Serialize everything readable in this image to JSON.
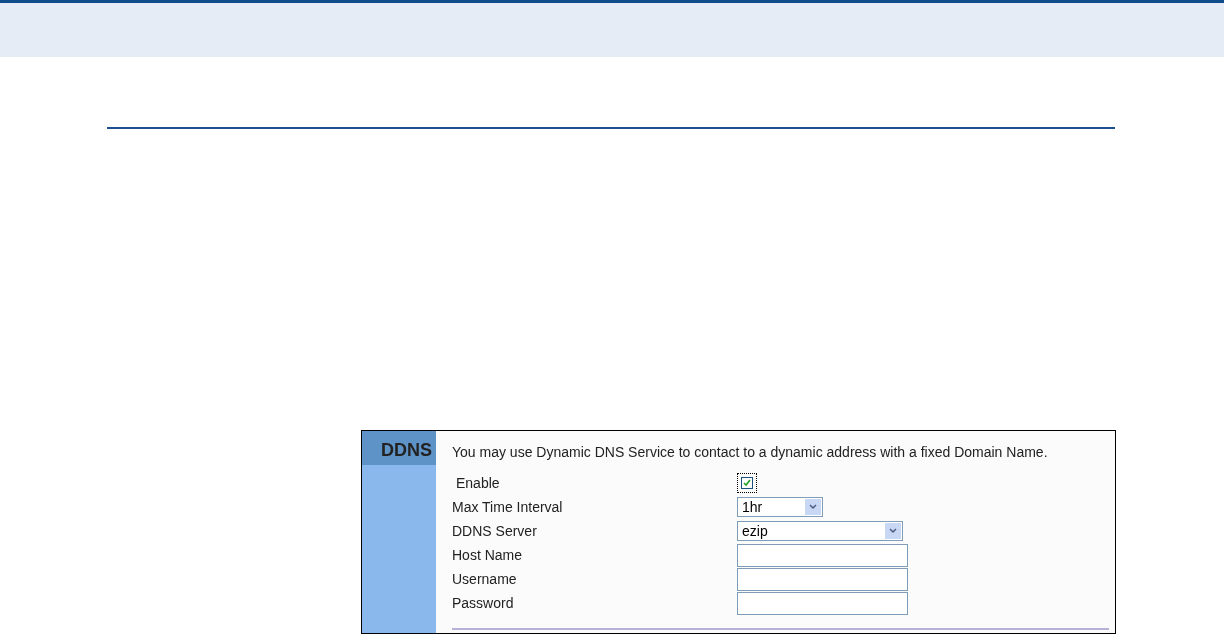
{
  "panel": {
    "title": "DDNS",
    "description": "You may use Dynamic DNS Service to contact to a dynamic address with a fixed Domain Name.",
    "fields": [
      {
        "kind": "checkbox",
        "label": "Enable",
        "checked": true
      },
      {
        "kind": "select",
        "label": "Max Time Interval",
        "value": "1hr"
      },
      {
        "kind": "select",
        "label": "DDNS Server",
        "value": "ezip"
      },
      {
        "kind": "text",
        "label": "Host Name"
      },
      {
        "kind": "text",
        "label": "Username"
      },
      {
        "kind": "text",
        "label": "Password"
      }
    ]
  }
}
